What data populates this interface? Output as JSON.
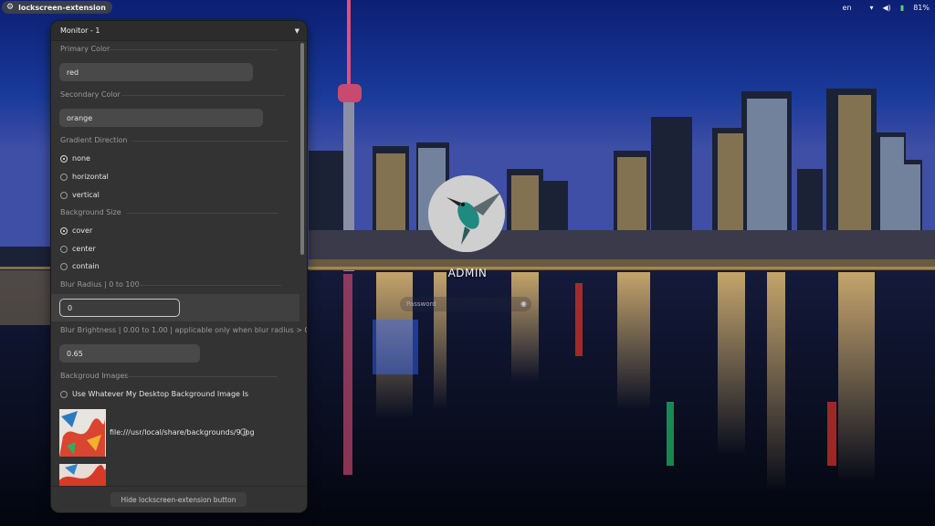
{
  "topbar": {
    "extension_label": "lockscreen-extension",
    "language": "en",
    "battery": "81%"
  },
  "panel": {
    "monitor": "Monitor - 1",
    "primary_color": {
      "label": "Primary Color",
      "value": "red"
    },
    "secondary_color": {
      "label": "Secondary Color",
      "value": "orange"
    },
    "gradient_direction": {
      "label": "Gradient Direction",
      "options": [
        "none",
        "horizontal",
        "vertical"
      ],
      "selected": "none"
    },
    "background_size": {
      "label": "Background Size",
      "options": [
        "cover",
        "center",
        "contain"
      ],
      "selected": "cover"
    },
    "blur_radius": {
      "label": "Blur Radius | 0 to 100",
      "value": "0"
    },
    "blur_brightness": {
      "label": "Blur Brightness | 0.00 to 1.00 | applicable only when blur radius > 0",
      "value": "0.65"
    },
    "background_images": {
      "label": "Backgroud Images",
      "desktop_option": "Use Whatever My Desktop Background Image Is",
      "images": [
        {
          "path": "file:///usr/local/share/backgrounds/9.jpg"
        }
      ]
    },
    "hide_button": "Hide lockscreen-extension button"
  },
  "login": {
    "username": "ADMIN",
    "password_placeholder": "Password"
  },
  "colors": {
    "panel_bg": "#333333",
    "field_bg": "#494949",
    "sky_top": "#0a1a6a",
    "water": "#050a1c"
  },
  "icons": {
    "extension": "gear-icon",
    "network": "wifi-icon",
    "sound": "speaker-icon",
    "battery": "battery-icon",
    "dropdown": "chevron-down-icon",
    "reveal": "eye-icon"
  }
}
